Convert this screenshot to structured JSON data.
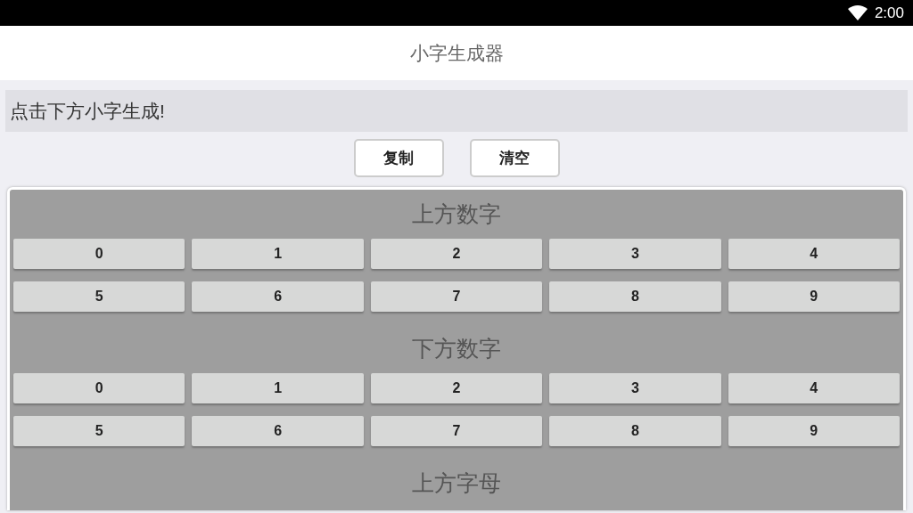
{
  "status_bar": {
    "time": "2:00"
  },
  "app_bar": {
    "title": "小字生成器"
  },
  "output": {
    "value": "点击下方小字生成!"
  },
  "buttons": [
    "复制",
    "清空"
  ],
  "sections": [
    {
      "title": "上方数字",
      "keys": [
        "0",
        "1",
        "2",
        "3",
        "4",
        "5",
        "6",
        "7",
        "8",
        "9"
      ]
    },
    {
      "title": "下方数字",
      "keys": [
        "0",
        "1",
        "2",
        "3",
        "4",
        "5",
        "6",
        "7",
        "8",
        "9"
      ]
    },
    {
      "title": "上方字母"
    }
  ]
}
